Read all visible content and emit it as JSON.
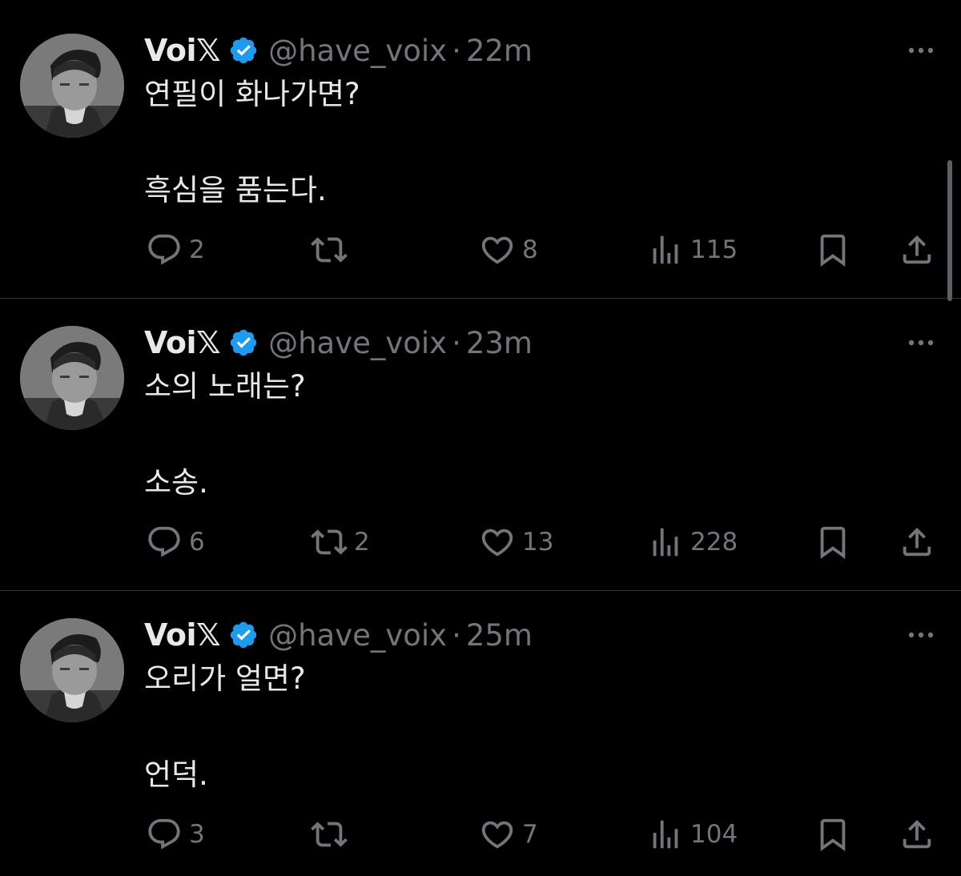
{
  "colors": {
    "background": "#000000",
    "text_primary": "#e7e9ea",
    "text_secondary": "#71767b",
    "verified_badge": "#1d9bf0",
    "divider": "#2f3336"
  },
  "tweets": [
    {
      "name": "Voi𝕏",
      "handle": "@have_voix",
      "separator": "·",
      "time": "22m",
      "question": "연필이 화나가면?",
      "answer": "흑심을 품는다.",
      "replies": "2",
      "retweets": "",
      "likes": "8",
      "views": "115"
    },
    {
      "name": "Voi𝕏",
      "handle": "@have_voix",
      "separator": "·",
      "time": "23m",
      "question": "소의 노래는?",
      "answer": "소송.",
      "replies": "6",
      "retweets": "2",
      "likes": "13",
      "views": "228"
    },
    {
      "name": "Voi𝕏",
      "handle": "@have_voix",
      "separator": "·",
      "time": "25m",
      "question": "오리가 얼면?",
      "answer": "언덕.",
      "replies": "3",
      "retweets": "",
      "likes": "7",
      "views": "104"
    }
  ],
  "icons": {
    "verified": "verified-badge-icon",
    "more": "more-dots-icon",
    "reply": "reply-bubble-icon",
    "retweet": "retweet-arrows-icon",
    "like": "heart-icon",
    "views": "bar-chart-icon",
    "bookmark": "bookmark-icon",
    "share": "share-upload-icon"
  }
}
